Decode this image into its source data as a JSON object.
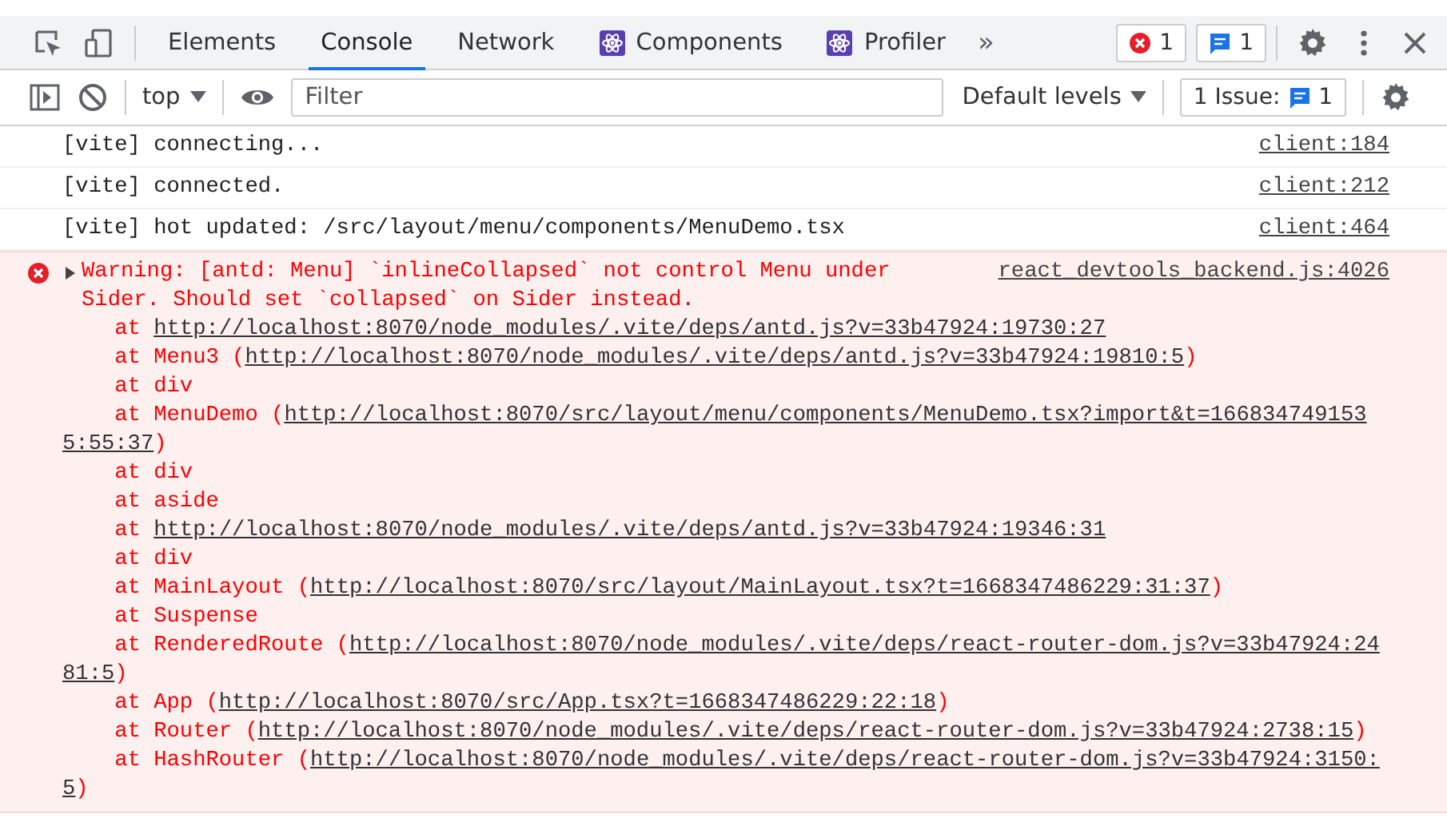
{
  "main_toolbar": {
    "tabs": [
      {
        "label": "Elements",
        "kind": "plain",
        "selected": false
      },
      {
        "label": "Console",
        "kind": "plain",
        "selected": true
      },
      {
        "label": "Network",
        "kind": "plain",
        "selected": false
      },
      {
        "label": "Components",
        "kind": "extension",
        "selected": false
      },
      {
        "label": "Profiler",
        "kind": "extension",
        "selected": false
      }
    ],
    "overflow": "»",
    "error_count": "1",
    "message_count": "1"
  },
  "console_toolbar": {
    "context": "top",
    "filter": {
      "placeholder": "Filter"
    },
    "levels": "Default levels",
    "issues_label": "1 Issue:",
    "issues_count": "1"
  },
  "messages": [
    {
      "kind": "log",
      "text": "[vite] connecting...",
      "source": "client:184"
    },
    {
      "kind": "log",
      "text": "[vite] connected.",
      "source": "client:212"
    },
    {
      "kind": "log",
      "text": "[vite] hot updated: /src/layout/menu/components/MenuDemo.tsx",
      "source": "client:464"
    },
    {
      "kind": "error",
      "expanded": false,
      "text": "Warning: [antd: Menu] `inlineCollapsed` not control Menu under Sider. Should set `collapsed` on Sider instead.",
      "source": "react_devtools_backend.js:4026",
      "stack": [
        {
          "text": "at ",
          "url": "http://localhost:8070/node_modules/.vite/deps/antd.js?v=33b47924:19730:27"
        },
        {
          "text": "at Menu3 (",
          "url": "http://localhost:8070/node_modules/.vite/deps/antd.js?v=33b47924:19810:5",
          "end": ")"
        },
        {
          "text": "at div"
        },
        {
          "text": "at MenuDemo (",
          "url": [
            "http://localhost:8070/src/layout/menu/components/MenuDemo.tsx?import&t=166834749153",
            "5:55:37"
          ],
          "end": ")"
        },
        {
          "text": "at div"
        },
        {
          "text": "at aside"
        },
        {
          "text": "at ",
          "url": "http://localhost:8070/node_modules/.vite/deps/antd.js?v=33b47924:19346:31"
        },
        {
          "text": "at div"
        },
        {
          "text": "at MainLayout (",
          "url": "http://localhost:8070/src/layout/MainLayout.tsx?t=1668347486229:31:37",
          "end": ")"
        },
        {
          "text": "at Suspense"
        },
        {
          "text": "at RenderedRoute (",
          "url": [
            "http://localhost:8070/node_modules/.vite/deps/react-router-dom.js?v=33b47924:24",
            "81:5"
          ],
          "end": ")"
        },
        {
          "text": "at App (",
          "url": "http://localhost:8070/src/App.tsx?t=1668347486229:22:18",
          "end": ")"
        },
        {
          "text": "at Router (",
          "url": "http://localhost:8070/node_modules/.vite/deps/react-router-dom.js?v=33b47924:2738:15",
          "end": ")"
        },
        {
          "text": "at HashRouter (",
          "url": [
            "http://localhost:8070/node_modules/.vite/deps/react-router-dom.js?v=33b47924:3150:",
            "5"
          ],
          "end": ")"
        }
      ]
    }
  ]
}
